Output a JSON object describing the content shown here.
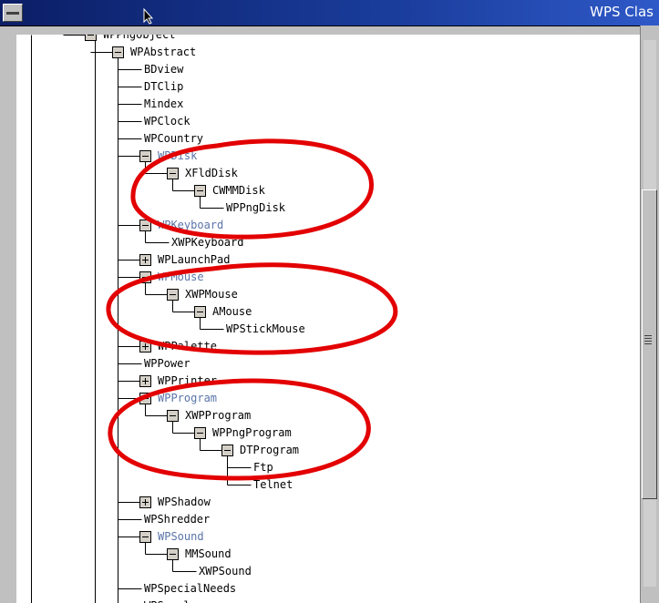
{
  "window": {
    "title": "WPS Clas"
  },
  "tree": {
    "nodes": [
      {
        "id": "n0",
        "label": "WPPngObject",
        "state": "expanded"
      },
      {
        "id": "n1",
        "label": "WPAbstract",
        "state": "expanded"
      },
      {
        "id": "n2",
        "label": "BDview",
        "state": "leaf"
      },
      {
        "id": "n3",
        "label": "DTClip",
        "state": "leaf"
      },
      {
        "id": "n4",
        "label": "Mindex",
        "state": "leaf"
      },
      {
        "id": "n5",
        "label": "WPClock",
        "state": "leaf"
      },
      {
        "id": "n6",
        "label": "WPCountry",
        "state": "leaf"
      },
      {
        "id": "n7",
        "label": "WPDisk",
        "state": "expanded",
        "highlight": true
      },
      {
        "id": "n8",
        "label": "XFldDisk",
        "state": "expanded"
      },
      {
        "id": "n9",
        "label": "CWMMDisk",
        "state": "expanded"
      },
      {
        "id": "n10",
        "label": "WPPngDisk",
        "state": "leaf"
      },
      {
        "id": "n11",
        "label": "WPKeyboard",
        "state": "expanded",
        "highlight": true
      },
      {
        "id": "n12",
        "label": "XWPKeyboard",
        "state": "leaf"
      },
      {
        "id": "n13",
        "label": "WPLaunchPad",
        "state": "collapsed"
      },
      {
        "id": "n14",
        "label": "WPMouse",
        "state": "expanded",
        "highlight": true
      },
      {
        "id": "n15",
        "label": "XWPMouse",
        "state": "expanded"
      },
      {
        "id": "n16",
        "label": "AMouse",
        "state": "expanded"
      },
      {
        "id": "n17",
        "label": "WPStickMouse",
        "state": "leaf"
      },
      {
        "id": "n18",
        "label": "WPPalette",
        "state": "collapsed"
      },
      {
        "id": "n19",
        "label": "WPPower",
        "state": "leaf"
      },
      {
        "id": "n20",
        "label": "WPPrinter",
        "state": "collapsed"
      },
      {
        "id": "n21",
        "label": "WPProgram",
        "state": "expanded",
        "highlight": true
      },
      {
        "id": "n22",
        "label": "XWPProgram",
        "state": "expanded"
      },
      {
        "id": "n23",
        "label": "WPPngProgram",
        "state": "expanded"
      },
      {
        "id": "n24",
        "label": "DTProgram",
        "state": "expanded"
      },
      {
        "id": "n25",
        "label": "Ftp",
        "state": "leaf"
      },
      {
        "id": "n26",
        "label": "Telnet",
        "state": "leaf"
      },
      {
        "id": "n27",
        "label": "WPShadow",
        "state": "collapsed"
      },
      {
        "id": "n28",
        "label": "WPShredder",
        "state": "leaf"
      },
      {
        "id": "n29",
        "label": "WPSound",
        "state": "expanded",
        "highlight": true
      },
      {
        "id": "n30",
        "label": "MMSound",
        "state": "expanded"
      },
      {
        "id": "n31",
        "label": "XWPSound",
        "state": "leaf"
      },
      {
        "id": "n32",
        "label": "WPSpecialNeeds",
        "state": "leaf"
      },
      {
        "id": "n33",
        "label": "WPSpool",
        "state": "leaf"
      }
    ]
  },
  "colors": {
    "highlight_text": "#5a74a8",
    "annotation": "#e30000",
    "titlebar": "#0b1e66"
  },
  "icons": {
    "system_menu": "system-menu-icon",
    "cursor": "mouse-pointer-icon",
    "expand": "plus-box-icon",
    "collapse": "minus-box-icon"
  }
}
